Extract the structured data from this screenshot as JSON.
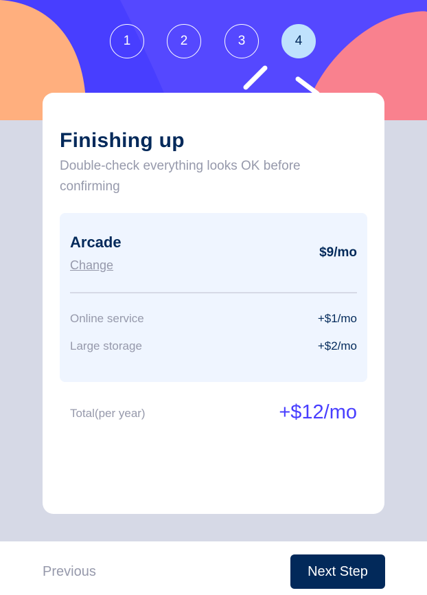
{
  "steps": [
    {
      "number": "1",
      "active": false
    },
    {
      "number": "2",
      "active": false
    },
    {
      "number": "3",
      "active": false
    },
    {
      "number": "4",
      "active": true
    }
  ],
  "header": {
    "title": "Finishing up",
    "subtitle": "Double-check everything looks OK before confirming"
  },
  "summary": {
    "plan_name": "Arcade",
    "change_label": "Change",
    "plan_price": "$9/mo",
    "addons": [
      {
        "label": "Online service",
        "price": "+$1/mo"
      },
      {
        "label": "Large storage",
        "price": "+$2/mo"
      }
    ]
  },
  "total": {
    "label": "Total(per year)",
    "price": "+$12/mo"
  },
  "footer": {
    "previous_label": "Previous",
    "next_label": "Next Step"
  },
  "colors": {
    "marine_blue": "#02295a",
    "purplish_blue": "#483eff",
    "cool_gray": "#9699ab",
    "light_gray": "#d6d9e6",
    "magnolia": "#eff5ff",
    "light_blue": "#bfe2fd",
    "orange": "#ffaf7e",
    "pink": "#f9818e"
  }
}
